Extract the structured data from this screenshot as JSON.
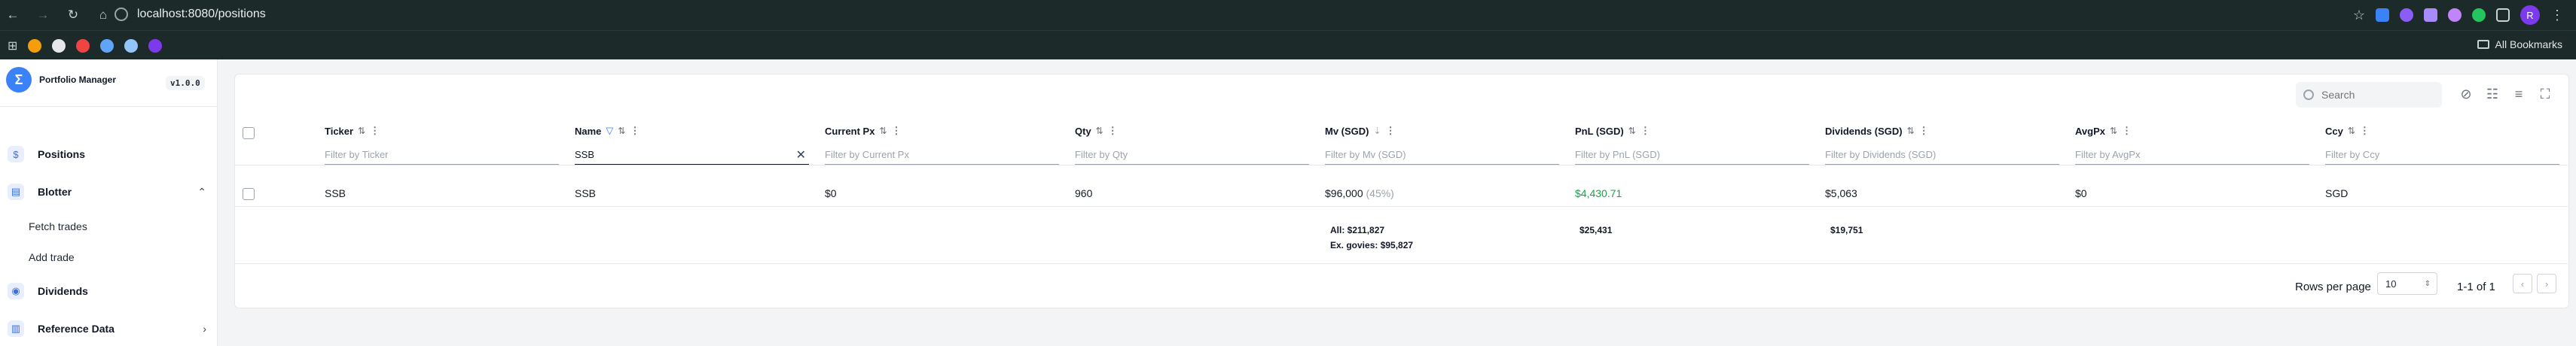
{
  "browser": {
    "url": "localhost:8080/positions",
    "bookmarks_label": "All Bookmarks",
    "profile_initial": "R"
  },
  "sidebar": {
    "brand_title": "Portfolio Manager",
    "brand_initial": "Σ",
    "version": "v1.0.0",
    "items": [
      {
        "label": "Positions",
        "icon": "dollar-icon"
      },
      {
        "label": "Blotter",
        "icon": "list-icon",
        "expanded": true
      },
      {
        "label": "Dividends",
        "icon": "dividends-icon"
      },
      {
        "label": "Reference Data",
        "icon": "book-icon"
      }
    ],
    "sub_items": [
      "Fetch trades",
      "Add trade"
    ]
  },
  "toolbar": {
    "search_placeholder": "Search"
  },
  "table": {
    "columns": [
      {
        "label": "Ticker",
        "filter_placeholder": "Filter by Ticker",
        "filter_value": ""
      },
      {
        "label": "Name",
        "filter_placeholder": "Filter by Name",
        "filter_value": "SSB"
      },
      {
        "label": "Current Px",
        "filter_placeholder": "Filter by Current Px",
        "filter_value": ""
      },
      {
        "label": "Qty",
        "filter_placeholder": "Filter by Qty",
        "filter_value": ""
      },
      {
        "label": "Mv (SGD)",
        "filter_placeholder": "Filter by Mv (SGD)",
        "filter_value": ""
      },
      {
        "label": "PnL (SGD)",
        "filter_placeholder": "Filter by PnL (SGD)",
        "filter_value": ""
      },
      {
        "label": "Dividends (SGD)",
        "filter_placeholder": "Filter by Dividends (SGD)",
        "filter_value": ""
      },
      {
        "label": "AvgPx",
        "filter_placeholder": "Filter by AvgPx",
        "filter_value": ""
      },
      {
        "label": "Ccy",
        "filter_placeholder": "Filter by Ccy",
        "filter_value": ""
      }
    ],
    "rows": [
      {
        "ticker": "SSB",
        "name": "SSB",
        "current_px": "$0",
        "qty": "960",
        "mv": "$96,000",
        "mv_pct": "(45%)",
        "pnl": "$4,430.71",
        "dividends": "$5,063",
        "avgpx": "$0",
        "ccy": "SGD"
      }
    ],
    "summary": {
      "mv_all": "All: $211,827",
      "mv_ex_govies": "Ex. govies: $95,827",
      "pnl_total": "$25,431",
      "dividends_total": "$19,751"
    }
  },
  "pagination": {
    "rows_per_page_label": "Rows per page",
    "rows_per_page_value": "10",
    "range_text": "1-1 of 1"
  },
  "colors": {
    "accent": "#3b82f6",
    "positive": "#16a34a",
    "chrome": "#1d2a2a"
  }
}
